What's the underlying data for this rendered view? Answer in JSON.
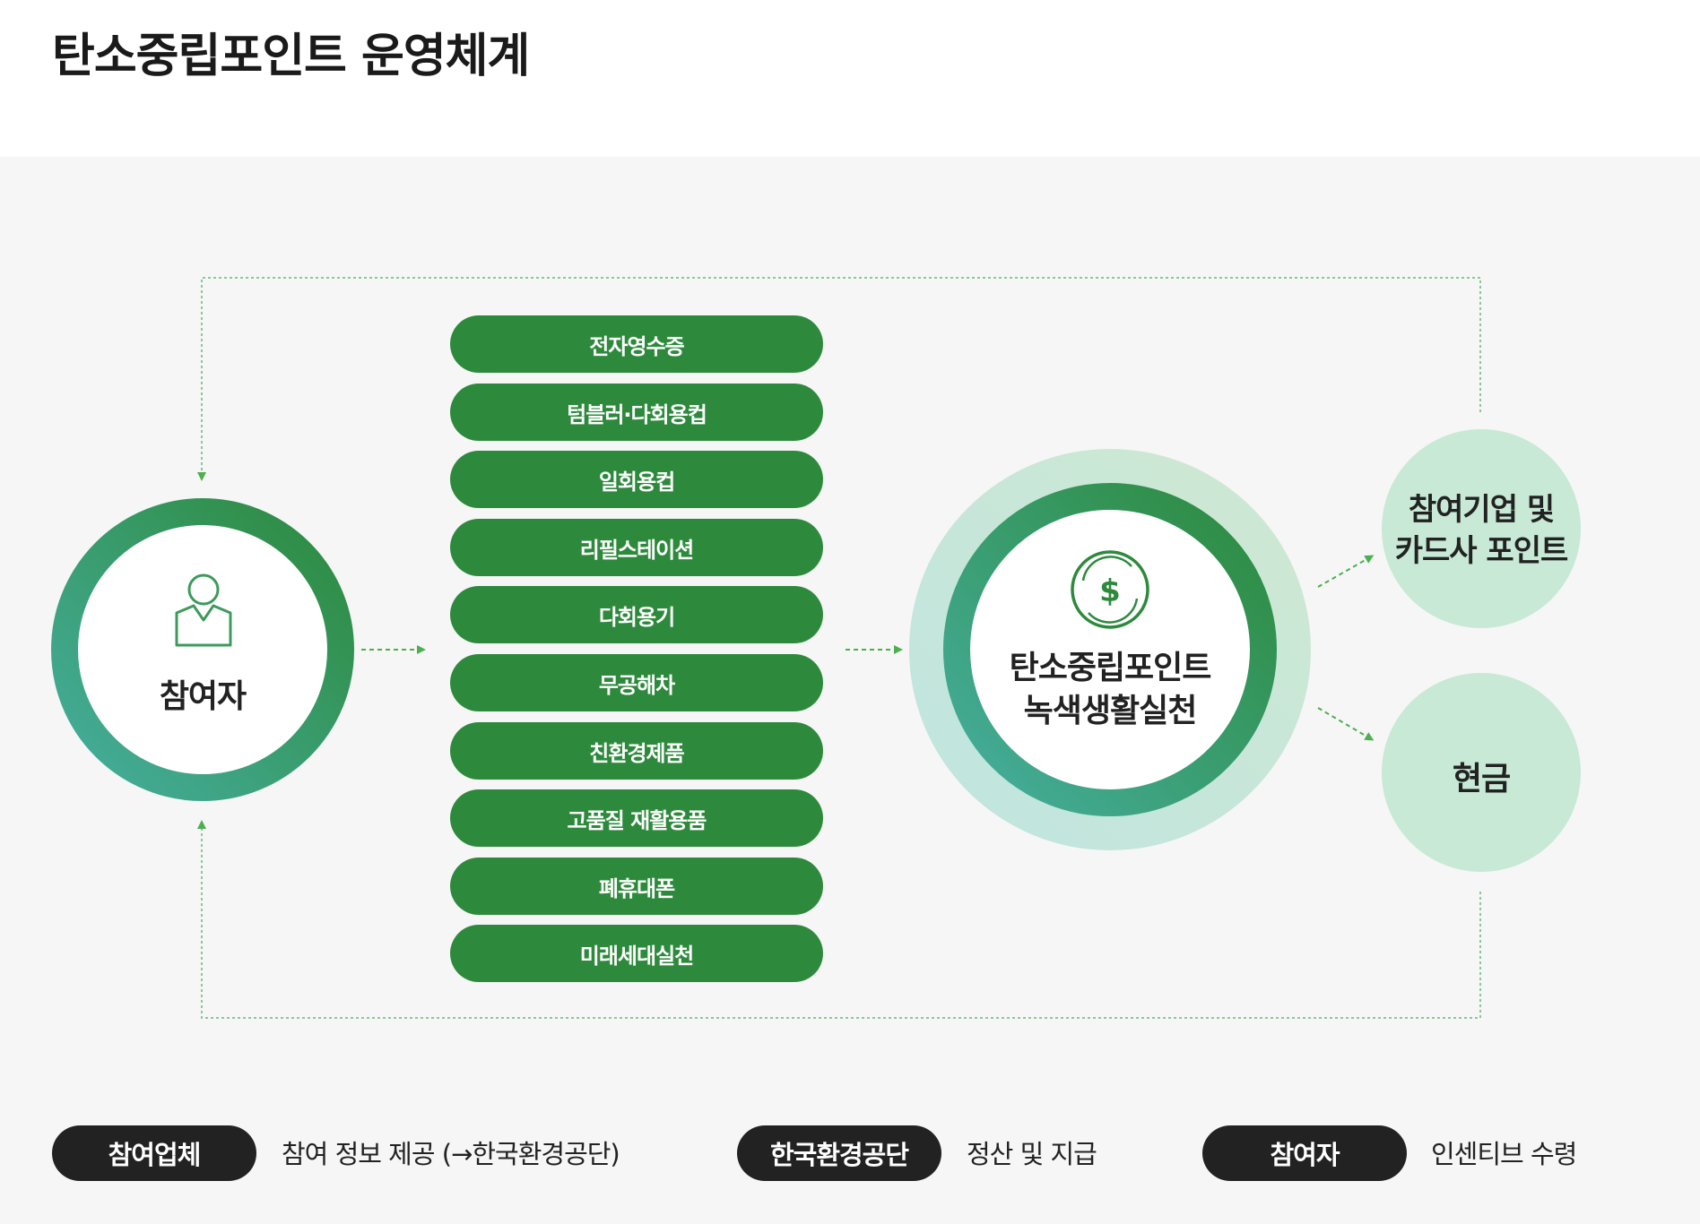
{
  "page_title": "탄소중립포인트 운영체계",
  "participant": {
    "label": "참여자",
    "icon": "person-icon"
  },
  "activities": [
    "전자영수증",
    "텀블러·다회용컵",
    "일회용컵",
    "리필스테이션",
    "다회용기",
    "무공해차",
    "친환경제품",
    "고품질 재활용품",
    "폐휴대폰",
    "미래세대실천"
  ],
  "center": {
    "line1": "탄소중립포인트",
    "line2": "녹색생활실천",
    "icon": "dollar-coin-icon"
  },
  "rewards": {
    "points_line1": "참여기업 및",
    "points_line2": "카드사 포인트",
    "cash": "현금"
  },
  "legend": [
    {
      "badge": "참여업체",
      "text": "참여 정보 제공 (→한국환경공단)"
    },
    {
      "badge": "한국환경공단",
      "text": "정산 및 지급"
    },
    {
      "badge": "참여자",
      "text": "인센티브 수령"
    }
  ],
  "colors": {
    "activity_green": "#2d8a3c",
    "ring_teal": "#45ae9f",
    "reward_mint": "#c7e9d6",
    "arrow_green": "#4caf50"
  }
}
